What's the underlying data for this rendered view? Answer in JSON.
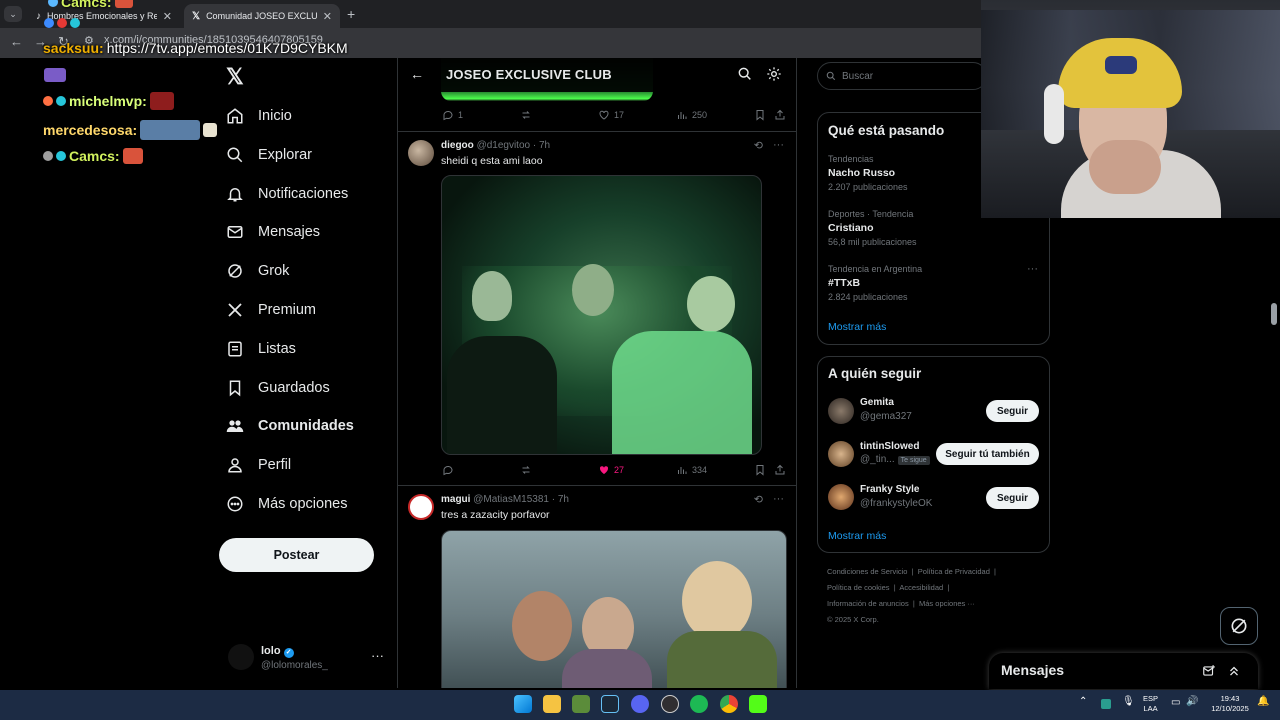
{
  "browser": {
    "tabs": [
      {
        "label": "Hombres Emocionales y Relaci"
      },
      {
        "label": "Comunidad JOSEO EXCLUSIVE"
      }
    ],
    "new_tab": "+",
    "url": "x.com/i/communities/1851039546407805159"
  },
  "chat": {
    "lines": [
      {
        "user": "Camcs:",
        "color": "#d1f15e"
      },
      {
        "user": "sacksuu:",
        "text": "https://7tv.app/emotes/01K7D9CYBKM",
        "color": "#f0b000"
      },
      {
        "user": "michelmvp:",
        "color": "#d9ff7a"
      },
      {
        "user": "mercedesosa:",
        "color": "#ffd86b"
      },
      {
        "user": "Camcs:",
        "color": "#d1f15e"
      }
    ]
  },
  "sidebar": {
    "items": [
      {
        "label": "Inicio",
        "icon": "home-icon"
      },
      {
        "label": "Explorar",
        "icon": "search-icon"
      },
      {
        "label": "Notificaciones",
        "icon": "bell-icon"
      },
      {
        "label": "Mensajes",
        "icon": "mail-icon"
      },
      {
        "label": "Grok",
        "icon": "grok-icon"
      },
      {
        "label": "Premium",
        "icon": "x-logo-icon"
      },
      {
        "label": "Listas",
        "icon": "list-icon"
      },
      {
        "label": "Guardados",
        "icon": "bookmark-icon"
      },
      {
        "label": "Comunidades",
        "icon": "communities-icon"
      },
      {
        "label": "Perfil",
        "icon": "user-icon"
      },
      {
        "label": "Más opciones",
        "icon": "more-circle-icon"
      }
    ],
    "post_button": "Postear",
    "account": {
      "name": "lolo",
      "handle": "@lolomorales_",
      "more": "···"
    }
  },
  "timeline": {
    "title": "JOSEO EXCLUSIVE CLUB",
    "first_actions": {
      "replies": "1",
      "reposts": "",
      "likes": "17",
      "views": "250"
    },
    "posts": [
      {
        "name": "diegoo",
        "handle": "@d1egvitoo",
        "time": "· 7h",
        "text": "sheidi q esta ami laoo",
        "replies": "",
        "reposts": "",
        "likes": "27",
        "views": "334"
      },
      {
        "name": "magui",
        "handle": "@MatiasM15381",
        "time": "· 7h",
        "text": "tres a zazacity porfavor"
      }
    ]
  },
  "right": {
    "search_placeholder": "Buscar",
    "trends_title": "Qué está pasando",
    "trends": [
      {
        "category": "Tendencias",
        "name": "Nacho Russo",
        "count": "2.207 publicaciones"
      },
      {
        "category": "Deportes · Tendencia",
        "name": "Cristiano",
        "count": "56,8 mil publicaciones"
      },
      {
        "category": "Tendencia en Argentina",
        "name": "#TTxB",
        "count": "2.824 publicaciones"
      }
    ],
    "trends_more": "Mostrar más",
    "follow_title": "A quién seguir",
    "follow": [
      {
        "name": "Gemita",
        "handle": "@gema327",
        "button": "Seguir"
      },
      {
        "name": "tintinSlowed",
        "handle": "@_tin...",
        "tag": "Te sigue",
        "button": "Seguir tú también"
      },
      {
        "name": "Franky Style",
        "handle": "@frankystyleOK",
        "button": "Seguir"
      }
    ],
    "follow_more": "Mostrar más",
    "footer": {
      "row1": [
        "Condiciones de Servicio",
        "Política de Privacidad"
      ],
      "row2": [
        "Política de cookies",
        "Accesibilidad"
      ],
      "row3": [
        "Información de anuncios",
        "Más opciones ···"
      ],
      "copyright": "© 2025 X Corp."
    }
  },
  "messages_drawer": {
    "title": "Mensajes"
  },
  "taskbar": {
    "lang_top": "ESP",
    "lang_bottom": "LAA",
    "time": "19:43",
    "date": "12/10/2025"
  }
}
